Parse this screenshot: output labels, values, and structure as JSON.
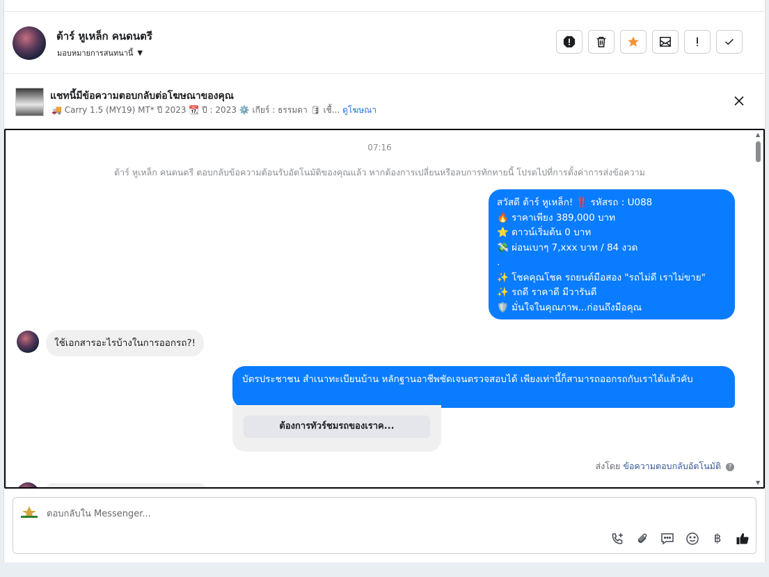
{
  "header": {
    "contact_name": "ต้าร์ หูเหล็ก คนดนตรี",
    "assign_label": "มอบหมายการสนทนานี้"
  },
  "ad_reply": {
    "title": "แชทนี้มีข้อความตอบกลับต่อโฆษณาของคุณ",
    "subtitle": "🚚 Carry 1.5 (MY19) MT* ปี 2023 📆 ปี : 2023 ⚙️ เกียร์ : ธรรมดา 🛢 เชื้...",
    "view_ad_link": "ดูโฆษณา"
  },
  "chat": {
    "time": "07:16",
    "auto_reply_notice": "ต้าร์ หูเหล็ก คนดนตรี ตอบกลับข้อความต้อนรับอัตโนมัติของคุณแล้ว หากต้องการเปลี่ยนหรือลบการทักทายนี้ โปรดไปที่การตั้งค่าการส่งข้อความ",
    "greeting_lines": [
      "สวัสดี ต้าร์ หูเหล็ก! ‼️ รหัสรถ : U088",
      "🔥 ราคาเพียง 389,000 บาท",
      "⭐ ดาวน์เริ่มต้น 0 บาท",
      "💸 ผ่อนเบาๆ 7,xxx บาท / 84 งวด",
      ".",
      "✨ โชคคุณโชค รถยนต์มือสอง \"รถไม่ดี เราไม่ขาย\"",
      "✨ รถดี ราคาดี มีวารันตี",
      "🛡️ มั่นใจในคุณภาพ...ก่อนถึงมือคุณ"
    ],
    "customer_question": "ใช้เอกสารอะไรบ้างในการออกรถ?!",
    "answer": "บัตรประชาชน สำเนาทะเบียนบ้าน หลักฐานอาชีพชัดเจนตรวจสอบได้ เพียงเท่านี้ก็สามารถออกรถกับเราได้แล้วคับ",
    "quick_reply_button": "ต้องการทัวร์ชมรถของเราค...",
    "sent_by_prefix": "ส่งโดย",
    "sent_by_link": "ข้อความตอบกลับอัตโนมัติ",
    "help_icon_glyph": "?"
  },
  "composer": {
    "placeholder": "ตอบกลับใน Messenger..."
  },
  "icons": {
    "header_actions": [
      "spam-alert-icon",
      "trash-icon",
      "star-icon",
      "mark-unread-icon",
      "exclamation-icon",
      "check-icon"
    ],
    "composer_tools": [
      "call-add-icon",
      "attachment-icon",
      "saved-reply-icon",
      "emoji-icon",
      "baht-icon",
      "thumbs-up-icon"
    ],
    "baht_glyph": "฿"
  },
  "colors": {
    "accent_blue": "#0a7cff",
    "star_orange": "#f7923a",
    "link_blue": "#216fdb"
  }
}
